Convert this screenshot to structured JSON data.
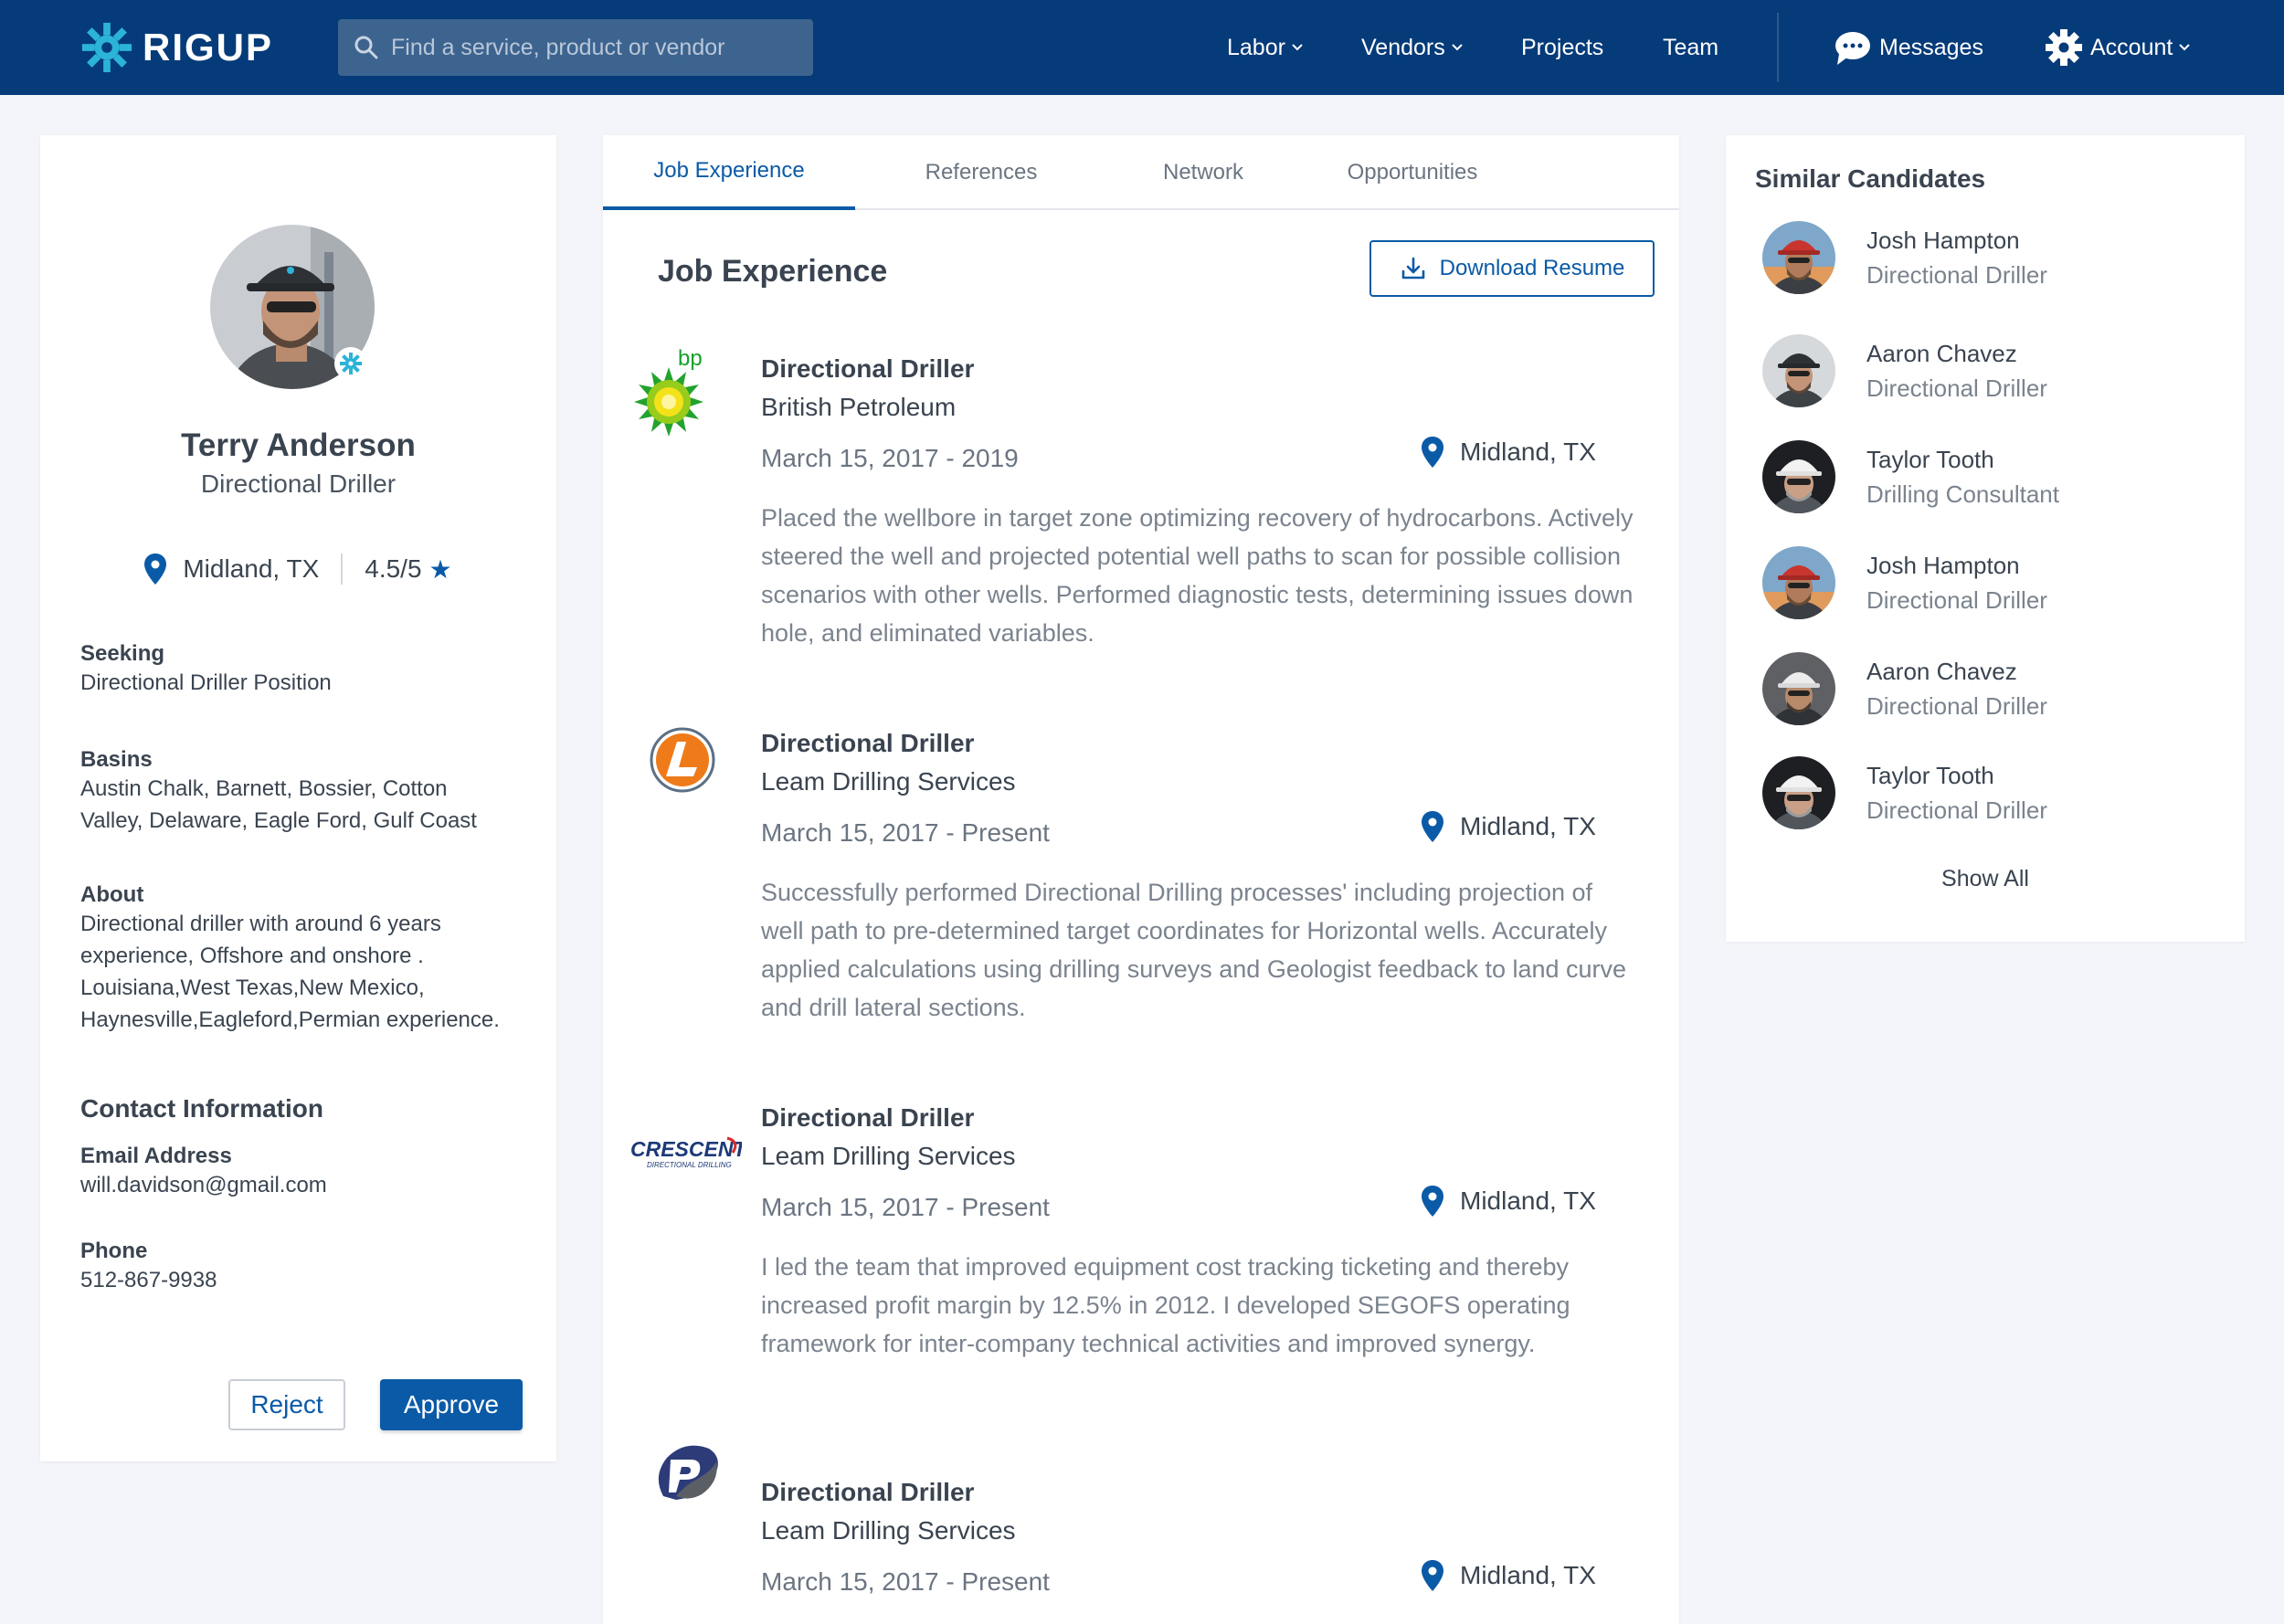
{
  "nav": {
    "brand": "RIGUP",
    "search_placeholder": "Find a service, product or vendor",
    "labor": "Labor",
    "vendors": "Vendors",
    "projects": "Projects",
    "team": "Team",
    "messages": "Messages",
    "account": "Account"
  },
  "profile": {
    "name": "Terry Anderson",
    "title": "Directional Driller",
    "location": "Midland, TX",
    "rating": "4.5/5",
    "seeking_label": "Seeking",
    "seeking": "Directional Driller Position",
    "basins_label": "Basins",
    "basins_line1": "Austin Chalk,  Barnett,  Bossier,  Cotton",
    "basins_line2": "Valley,  Delaware,  Eagle Ford,  Gulf Coast",
    "about_label": "About",
    "about_line1": "Directional driller with around 6 years",
    "about_line2": "experience, Offshore and onshore .",
    "about_line3": "Louisiana,West Texas,New Mexico,",
    "about_line4": "Haynesville,Eagleford,Permian experience.",
    "contact_heading": "Contact Information",
    "email_label": "Email Address",
    "email": "will.davidson@gmail.com",
    "phone_label": "Phone",
    "phone": "512-867-9938",
    "reject": "Reject",
    "approve": "Approve"
  },
  "tabs": [
    "Job Experience",
    "References",
    "Network",
    "Opportunities"
  ],
  "experience": {
    "heading": "Job Experience",
    "download": "Download Resume",
    "jobs": [
      {
        "title": "Directional Driller",
        "company": "British Petroleum",
        "dates": "March 15, 2017 - 2019",
        "location": "Midland, TX",
        "logo": "bp-logo",
        "desc": "Placed the wellbore in target zone optimizing recovery of hydrocarbons. Actively steered the well and projected potential well paths to scan for possible collision scenarios with other wells. Performed diagnostic tests, determining issues down hole, and eliminated variables."
      },
      {
        "title": "Directional Driller",
        "company": "Leam Drilling Services",
        "dates": "March 15, 2017 - Present",
        "location": "Midland, TX",
        "logo": "leam-logo",
        "desc": "Successfully performed Directional Drilling processes' including projection of well path to pre-determined target coordinates for Horizontal wells. Accurately applied calculations using drilling surveys and Geologist feedback to land curve and drill lateral sections."
      },
      {
        "title": "Directional Driller",
        "company": "Leam Drilling Services",
        "dates": "March 15, 2017 - Present",
        "location": "Midland, TX",
        "logo": "crescent-logo",
        "logo_text": "CRESCENT",
        "logo_sub": "DIRECTIONAL DRILLING",
        "desc": "I led the team that improved equipment cost tracking ticketing and thereby increased profit margin by 12.5% in 2012. I developed SEGOFS operating framework for inter-company technical activities and improved synergy."
      },
      {
        "title": "Directional Driller",
        "company": "Leam Drilling Services",
        "dates": "March 15, 2017 - Present",
        "location": "Midland, TX",
        "logo": "p-logo",
        "desc": ""
      }
    ]
  },
  "similar": {
    "heading": "Similar Candidates",
    "show_all": "Show All",
    "candidates": [
      {
        "name": "Josh Hampton",
        "title": "Directional Driller"
      },
      {
        "name": "Aaron Chavez",
        "title": "Directional Driller"
      },
      {
        "name": "Taylor Tooth",
        "title": "Drilling Consultant"
      },
      {
        "name": "Josh Hampton",
        "title": "Directional Driller"
      },
      {
        "name": "Aaron Chavez",
        "title": "Directional Driller"
      },
      {
        "name": "Taylor Tooth",
        "title": "Directional Driller"
      }
    ]
  },
  "colors": {
    "nav_bg": "#063b7a",
    "accent": "#0a5aa8",
    "page_bg": "#f4f5fa",
    "brand_icon": "#2bb3d8"
  }
}
